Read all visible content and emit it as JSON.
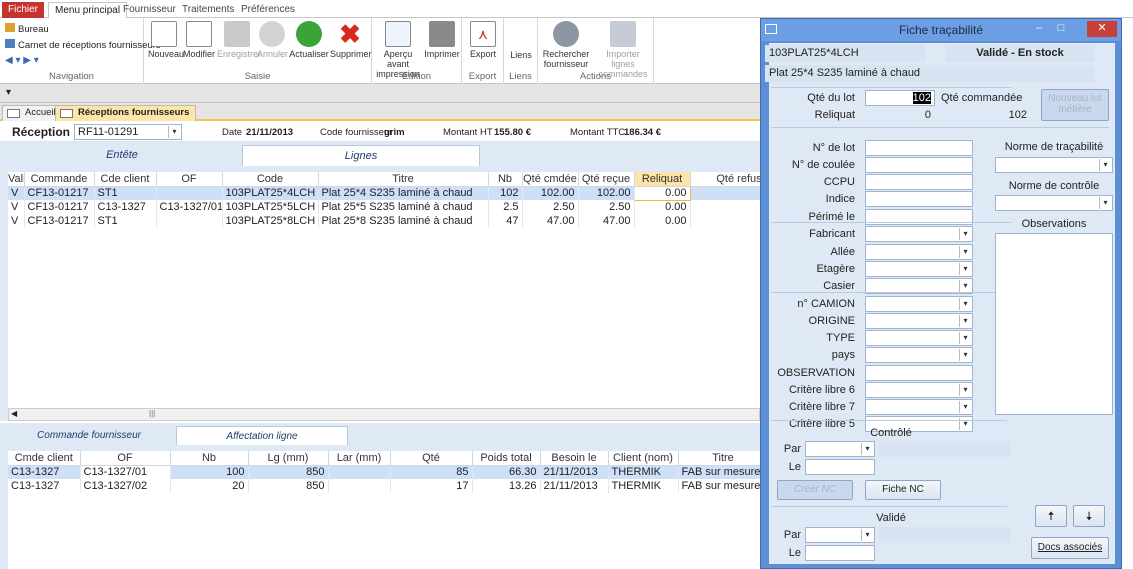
{
  "ribbon_tabs": [
    "Fichier",
    "Menu principal",
    "Fournisseur",
    "Traitements",
    "Préférences"
  ],
  "navigation": {
    "items": [
      "Bureau",
      "Carnet de réceptions fournisseurs"
    ],
    "group_label": "Navigation"
  },
  "saisie": {
    "buttons": [
      "Nouveau",
      "Modifier",
      "Enregistrer",
      "Annuler",
      "Actualiser",
      "Supprimer"
    ],
    "group_label": "Saisie"
  },
  "edition": {
    "buttons": [
      "Aperçu avant impression",
      "Imprimer"
    ],
    "group_label": "Edition"
  },
  "export": {
    "button": "Export",
    "group_label": "Export"
  },
  "liens": {
    "button": "Liens",
    "group_label": "Liens"
  },
  "actions": {
    "buttons": [
      "Rechercher fournisseur",
      "Importer lignes commandes"
    ],
    "group_label": "Actions"
  },
  "doc_tabs": [
    "Accueil",
    "Réceptions fournisseurs"
  ],
  "form_header": {
    "reception_label": "Réception",
    "reception_value": "RF11-01291",
    "date_label": "Date",
    "date_value": "21/11/2013",
    "code_fournisseur_label": "Code fournisseur",
    "code_fournisseur_value": "grim",
    "montant_ht_label": "Montant HT",
    "montant_ht_value": "155.80 €",
    "montant_ttc_label": "Montant TTC",
    "montant_ttc_value": "186.34 €"
  },
  "sub_tabs": [
    "Entête",
    "Lignes"
  ],
  "lines_grid": {
    "columns": [
      "Valid",
      "Commande",
      "Cde client",
      "OF",
      "Code",
      "Titre",
      "Nb",
      "Qté cmdée",
      "Qté reçue",
      "Reliquat",
      "Qté refus"
    ],
    "rows": [
      [
        "V",
        "CF13-01217",
        "ST1",
        "",
        "103PLAT25*4LCH",
        "Plat 25*4 S235 laminé à chaud",
        "102",
        "102.00",
        "102.00",
        "0.00",
        ""
      ],
      [
        "V",
        "CF13-01217",
        "C13-1327",
        "C13-1327/01",
        "103PLAT25*5LCH",
        "Plat 25*5 S235 laminé à chaud",
        "2.5",
        "2.50",
        "2.50",
        "0.00",
        ""
      ],
      [
        "V",
        "CF13-01217",
        "ST1",
        "",
        "103PLAT25*8LCH",
        "Plat 25*8 S235 laminé à chaud",
        "47",
        "47.00",
        "47.00",
        "0.00",
        ""
      ]
    ]
  },
  "sub2_tabs": [
    "Commande fournisseur",
    "Affectation ligne"
  ],
  "affect_grid": {
    "columns": [
      "Cmde client",
      "OF",
      "Nb",
      "Lg (mm)",
      "Lar (mm)",
      "Qté",
      "Poids total",
      "Besoin le",
      "Client (nom)",
      "Titre"
    ],
    "rows": [
      [
        "C13-1327",
        "C13-1327/01",
        "100",
        "850",
        "",
        "85",
        "66.30",
        "21/11/2013",
        "THERMIK",
        "FAB sur mesure"
      ],
      [
        "C13-1327",
        "C13-1327/02",
        "20",
        "850",
        "",
        "17",
        "13.26",
        "21/11/2013",
        "THERMIK",
        "FAB sur mesure"
      ]
    ]
  },
  "dialog": {
    "title": "Fiche traçabilité",
    "code": "103PLAT25*4LCH",
    "status": "Validé - En stock",
    "description": "Plat 25*4 S235 laminé à chaud",
    "qte_lot_label": "Qté du lot",
    "qte_lot_value": "102",
    "qte_commandee_label": "Qté commandée",
    "qte_commandee_value": "102",
    "reliquat_label": "Reliquat",
    "reliquat_value": "0",
    "nouveau_lot_button": "Nouveau lot métière",
    "fields": [
      "N° de lot",
      "N° de coulée",
      "CCPU",
      "Indice",
      "Périmé le",
      "Fabricant",
      "Allée",
      "Etagère",
      "Casier",
      "n° CAMION",
      "ORIGINE",
      "TYPE",
      "pays",
      "OBSERVATION",
      "Critère libre 6",
      "Critère libre 7",
      "Critère libre 5"
    ],
    "norme_tracabilite_label": "Norme de traçabilité",
    "norme_controle_label": "Norme de contrôle",
    "observations_label": "Observations",
    "controle_label": "Contrôlé",
    "valide_label": "Validé",
    "par_label": "Par",
    "le_label": "Le",
    "creer_nc_button": "Créer NC",
    "fiche_nc_button": "Fiche NC",
    "docs_button": "Docs associés"
  }
}
